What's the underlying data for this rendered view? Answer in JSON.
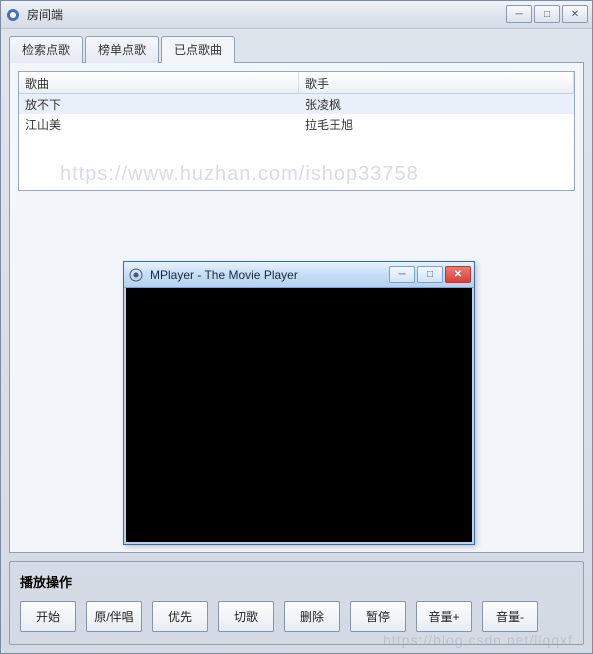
{
  "window": {
    "title": "房间端"
  },
  "tabs": [
    {
      "label": "检索点歌"
    },
    {
      "label": "榜单点歌"
    },
    {
      "label": "已点歌曲"
    }
  ],
  "active_tab_index": 2,
  "table": {
    "headers": {
      "song": "歌曲",
      "singer": "歌手"
    },
    "rows": [
      {
        "song": "放不下",
        "singer": "张凌枫"
      },
      {
        "song": "江山美",
        "singer": "拉毛王旭"
      }
    ]
  },
  "mplayer": {
    "title": "MPlayer - The Movie Player"
  },
  "playback": {
    "legend": "播放操作",
    "buttons": {
      "start": "开始",
      "original_accompaniment": "原/伴唱",
      "priority": "优先",
      "cut": "切歌",
      "delete": "删除",
      "pause": "暂停",
      "vol_up": "音量+",
      "vol_down": "音量-"
    }
  },
  "watermarks": {
    "main": "https://www.huzhan.com/ishop33758",
    "footer": "https://blog.csdn.net/llqqxf"
  },
  "glyphs": {
    "minimize": "─",
    "maximize": "□",
    "close": "✕"
  }
}
